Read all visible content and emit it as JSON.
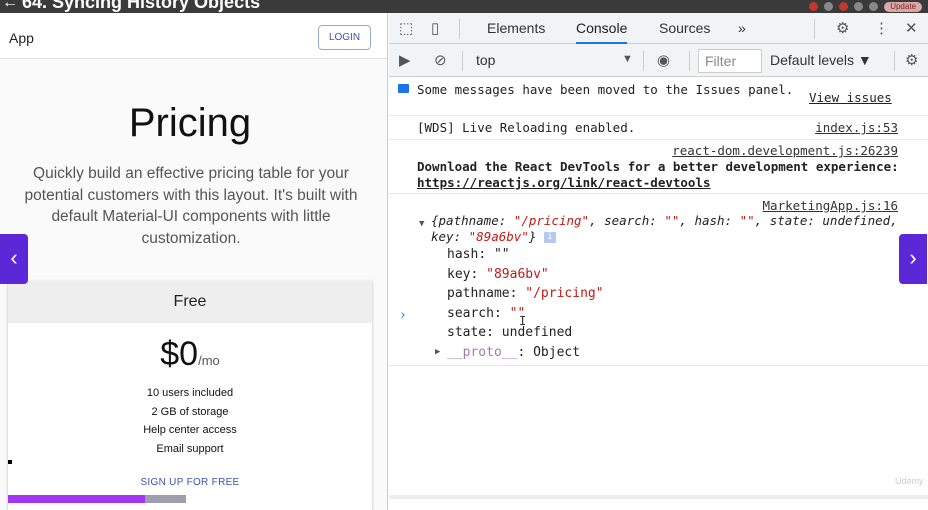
{
  "video": {
    "title": "64. Syncing History Objects",
    "back_icon": "back-arrow-icon",
    "update_badge": "Update"
  },
  "app": {
    "brand": "App",
    "login_label": "LOGIN",
    "pricing_title": "Pricing",
    "pricing_subtitle": "Quickly build an effective pricing table for your potential customers with this layout. It's built with default Material-UI components with little customization.",
    "card": {
      "tier": "Free",
      "price": "$0",
      "period": "/mo",
      "features": [
        "10 users included",
        "2 GB of storage",
        "Help center access",
        "Email support"
      ],
      "cta": "SIGN UP FOR FREE"
    },
    "progress_fraction": 0.77
  },
  "nav": {
    "prev_glyph": "‹",
    "next_glyph": "›"
  },
  "devtools": {
    "tabs": [
      "Elements",
      "Console",
      "Sources"
    ],
    "more_tabs": "»",
    "active_tab": "Console",
    "context": "top",
    "filter_placeholder": "Filter",
    "levels": "Default levels ▼",
    "messages": {
      "issues_text": "Some messages have been moved to the Issues panel.",
      "issues_link": "View issues",
      "wds_text": "[WDS] Live Reloading enabled.",
      "wds_src": "index.js:53",
      "react_src": "react-dom.development.js:26239",
      "react_text": "Download the React DevTools for a better development experience:",
      "react_link": "https://reactjs.org/link/react-devtools",
      "obj_src": "MarketingApp.js:16",
      "obj_summary_1": "{pathname: ",
      "obj_summary_pathname": "\"/pricing\"",
      "obj_summary_2": ", search: ",
      "obj_summary_search": "\"\"",
      "obj_summary_3": ", hash: ",
      "obj_summary_hash": "\"\"",
      "obj_summary_4": ", state: undefi",
      "obj_summary_5": "ned, key: ",
      "obj_summary_key": "\"89a6bv\"",
      "obj_summary_6": "}",
      "props": [
        {
          "key": "hash",
          "value": "\"\""
        },
        {
          "key": "key",
          "value": "\"89a6bv\""
        },
        {
          "key": "pathname",
          "value": "\"/pricing\""
        },
        {
          "key": "search",
          "value": "\"\""
        },
        {
          "key": "state",
          "value": "undefined"
        }
      ],
      "proto_key": "__proto__",
      "proto_value": "Object"
    },
    "prompt": "›",
    "text_cursor": "I"
  },
  "watermark": "Udemy"
}
